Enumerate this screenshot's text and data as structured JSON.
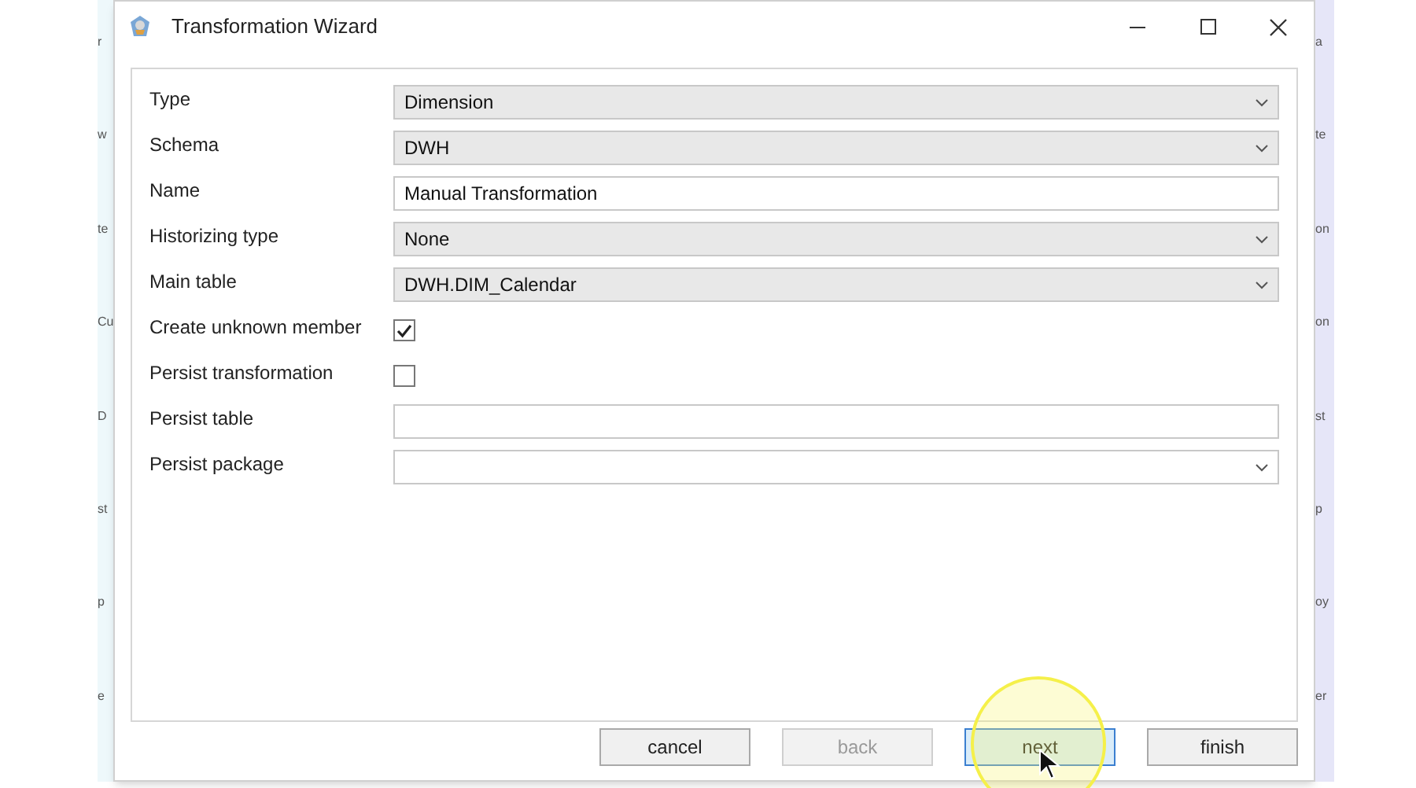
{
  "background_window": {
    "left_fragments": [
      "r",
      "w",
      "te",
      "Cu",
      "D",
      "st",
      "p",
      "e"
    ],
    "right_fragments": [
      "a",
      "te",
      "on",
      "on",
      "st",
      "p",
      "oy",
      "er"
    ]
  },
  "window": {
    "title": "Transformation Wizard"
  },
  "fields": [
    {
      "label": "Type",
      "kind": "dropdown",
      "value": "Dimension"
    },
    {
      "label": "Schema",
      "kind": "dropdown",
      "value": "DWH"
    },
    {
      "label": "Name",
      "kind": "text",
      "value": "Manual Transformation"
    },
    {
      "label": "Historizing type",
      "kind": "dropdown",
      "value": "None"
    },
    {
      "label": "Main table",
      "kind": "dropdown",
      "value": "DWH.DIM_Calendar"
    },
    {
      "label": "Create unknown member",
      "kind": "checkbox",
      "checked": true
    },
    {
      "label": "Persist transformation",
      "kind": "checkbox",
      "checked": false
    },
    {
      "label": "Persist table",
      "kind": "text"
    },
    {
      "label": "Persist package",
      "kind": "combobox"
    }
  ],
  "buttons": [
    {
      "label": "cancel",
      "disabled": false,
      "selected": false
    },
    {
      "label": "back",
      "disabled": true,
      "selected": false
    },
    {
      "label": "next",
      "disabled": false,
      "selected": true
    },
    {
      "label": "finish",
      "disabled": false,
      "selected": false
    }
  ]
}
